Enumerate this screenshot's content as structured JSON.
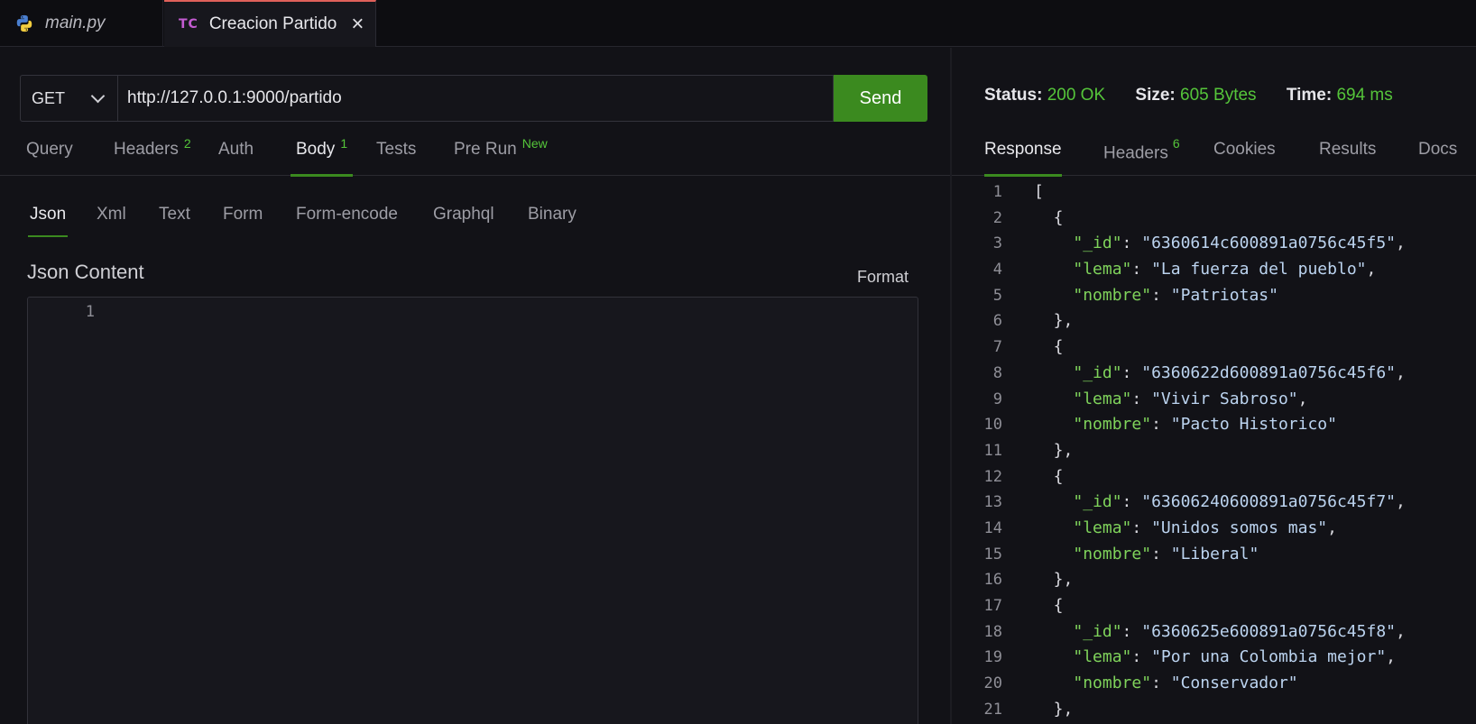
{
  "tabs": [
    {
      "label": "main.py",
      "icon": "python-icon",
      "active": false
    },
    {
      "label": "Creacion Partido",
      "icon_text": "TC",
      "active": true
    }
  ],
  "request": {
    "method": "GET",
    "url": "http://127.0.0.1:9000/partido",
    "send_label": "Send",
    "tabs": [
      {
        "label": "Query",
        "badge": ""
      },
      {
        "label": "Headers",
        "badge": "2"
      },
      {
        "label": "Auth",
        "badge": ""
      },
      {
        "label": "Body",
        "badge": "1"
      },
      {
        "label": "Tests",
        "badge": ""
      },
      {
        "label": "Pre Run",
        "badge": "New"
      }
    ],
    "body_tabs": [
      "Json",
      "Xml",
      "Text",
      "Form",
      "Form-encode",
      "Graphql",
      "Binary"
    ],
    "json_content_label": "Json Content",
    "format_label": "Format",
    "editor_line": "1"
  },
  "response": {
    "status_label": "Status:",
    "status_value": "200 OK",
    "size_label": "Size:",
    "size_value": "605 Bytes",
    "time_label": "Time:",
    "time_value": "694 ms",
    "tabs": [
      {
        "label": "Response",
        "badge": ""
      },
      {
        "label": "Headers",
        "badge": "6"
      },
      {
        "label": "Cookies",
        "badge": ""
      },
      {
        "label": "Results",
        "badge": ""
      },
      {
        "label": "Docs",
        "badge": ""
      }
    ],
    "items": [
      {
        "_id": "6360614c600891a0756c45f5",
        "lema": "La fuerza del pueblo",
        "nombre": "Patriotas"
      },
      {
        "_id": "6360622d600891a0756c45f6",
        "lema": "Vivir Sabroso",
        "nombre": "Pacto Historico"
      },
      {
        "_id": "63606240600891a0756c45f7",
        "lema": "Unidos somos mas",
        "nombre": "Liberal"
      },
      {
        "_id": "6360625e600891a0756c45f8",
        "lema": "Por una Colombia mejor",
        "nombre": "Conservador"
      }
    ]
  },
  "colors": {
    "accent_green": "#3b8a1f",
    "value_green": "#55c53a",
    "tab_top_border": "#e0605a"
  }
}
